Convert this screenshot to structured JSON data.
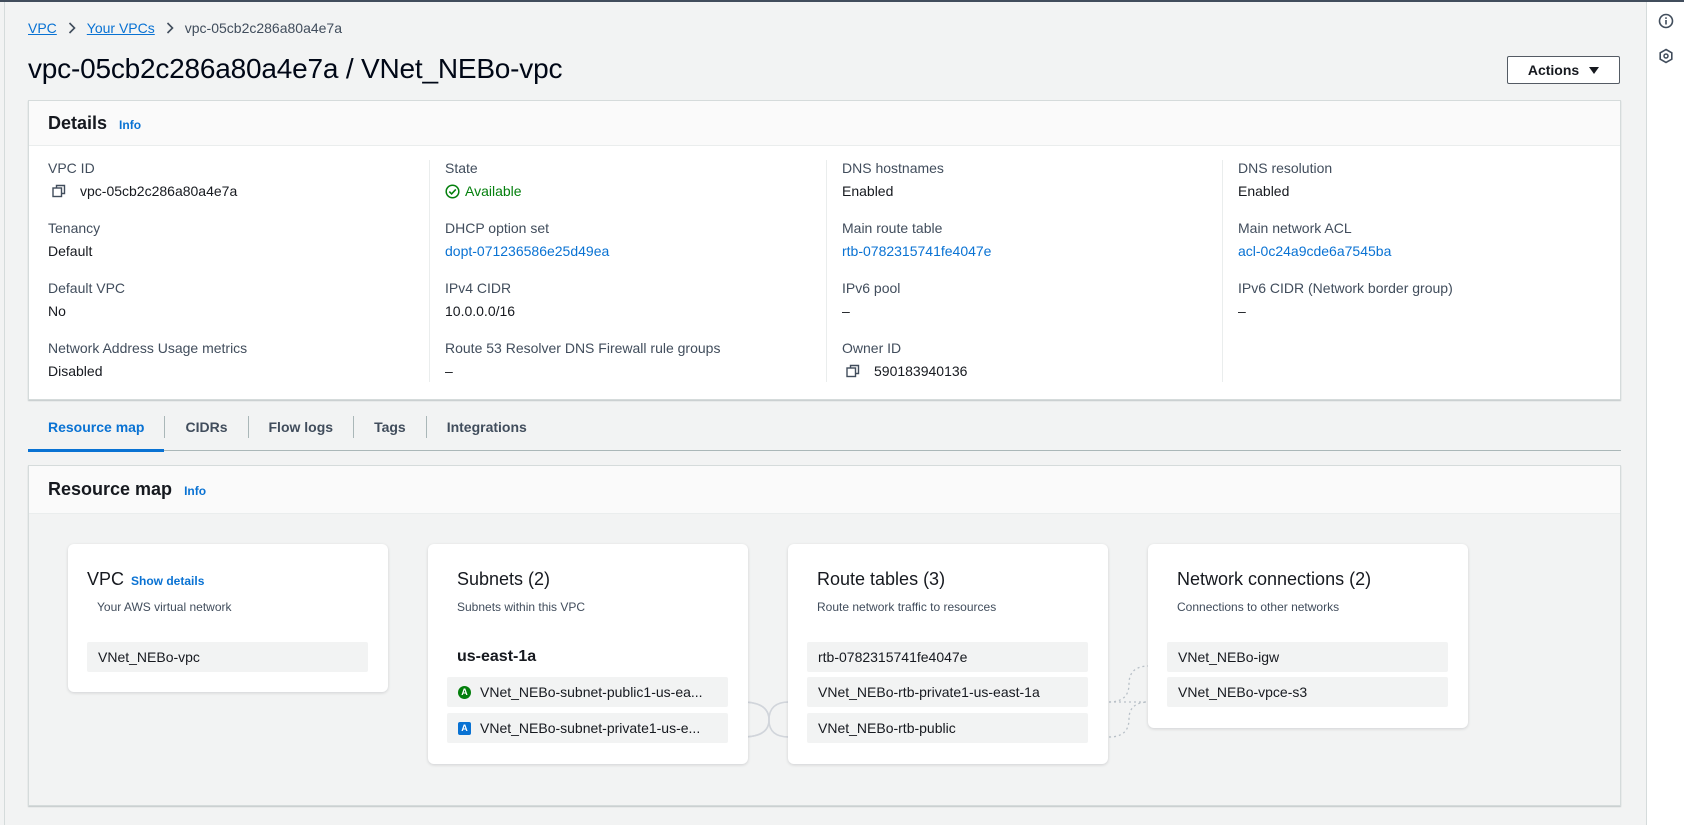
{
  "breadcrumb": {
    "vpc": "VPC",
    "your_vpcs": "Your VPCs",
    "current": "vpc-05cb2c286a80a4e7a"
  },
  "page_title": "vpc-05cb2c286a80a4e7a / VNet_NEBo-vpc",
  "actions_label": "Actions",
  "details": {
    "title": "Details",
    "info": "Info",
    "vpc_id": {
      "label": "VPC ID",
      "value": "vpc-05cb2c286a80a4e7a"
    },
    "tenancy": {
      "label": "Tenancy",
      "value": "Default"
    },
    "default_vpc": {
      "label": "Default VPC",
      "value": "No"
    },
    "nau_metrics": {
      "label": "Network Address Usage metrics",
      "value": "Disabled"
    },
    "state": {
      "label": "State",
      "value": "Available"
    },
    "dhcp": {
      "label": "DHCP option set",
      "value": "dopt-071236586e25d49ea"
    },
    "ipv4": {
      "label": "IPv4 CIDR",
      "value": "10.0.0.0/16"
    },
    "r53": {
      "label": "Route 53 Resolver DNS Firewall rule groups",
      "value": "–"
    },
    "dns_hostnames": {
      "label": "DNS hostnames",
      "value": "Enabled"
    },
    "main_rt": {
      "label": "Main route table",
      "value": "rtb-0782315741fe4047e"
    },
    "ipv6_pool": {
      "label": "IPv6 pool",
      "value": "–"
    },
    "owner": {
      "label": "Owner ID",
      "value": "590183940136"
    },
    "dns_resolution": {
      "label": "DNS resolution",
      "value": "Enabled"
    },
    "main_acl": {
      "label": "Main network ACL",
      "value": "acl-0c24a9cde6a7545ba"
    },
    "ipv6_cidr": {
      "label": "IPv6 CIDR (Network border group)",
      "value": "–"
    }
  },
  "tabs": [
    "Resource map",
    "CIDRs",
    "Flow logs",
    "Tags",
    "Integrations"
  ],
  "resource_map": {
    "title": "Resource map",
    "info": "Info",
    "vpc_card": {
      "title": "VPC",
      "show_details": "Show details",
      "subtitle": "Your AWS virtual network",
      "item": "VNet_NEBo-vpc"
    },
    "subnets_card": {
      "title": "Subnets (2)",
      "subtitle": "Subnets within this VPC",
      "az": "us-east-1a",
      "items": [
        {
          "label": "VNet_NEBo-subnet-public1-us-ea...",
          "badge": "A",
          "badge_color": "#037f0c"
        },
        {
          "label": "VNet_NEBo-subnet-private1-us-e...",
          "badge": "A",
          "badge_color": "#0972d3"
        }
      ]
    },
    "route_tables_card": {
      "title": "Route tables (3)",
      "subtitle": "Route network traffic to resources",
      "items": [
        "rtb-0782315741fe4047e",
        "VNet_NEBo-rtb-private1-us-east-1a",
        "VNet_NEBo-rtb-public"
      ]
    },
    "network_card": {
      "title": "Network connections (2)",
      "subtitle": "Connections to other networks",
      "items": [
        "VNet_NEBo-igw",
        "VNet_NEBo-vpce-s3"
      ]
    }
  },
  "colors": {
    "link": "#0972d3",
    "success": "#037f0c",
    "border": "#d5dbdb"
  }
}
